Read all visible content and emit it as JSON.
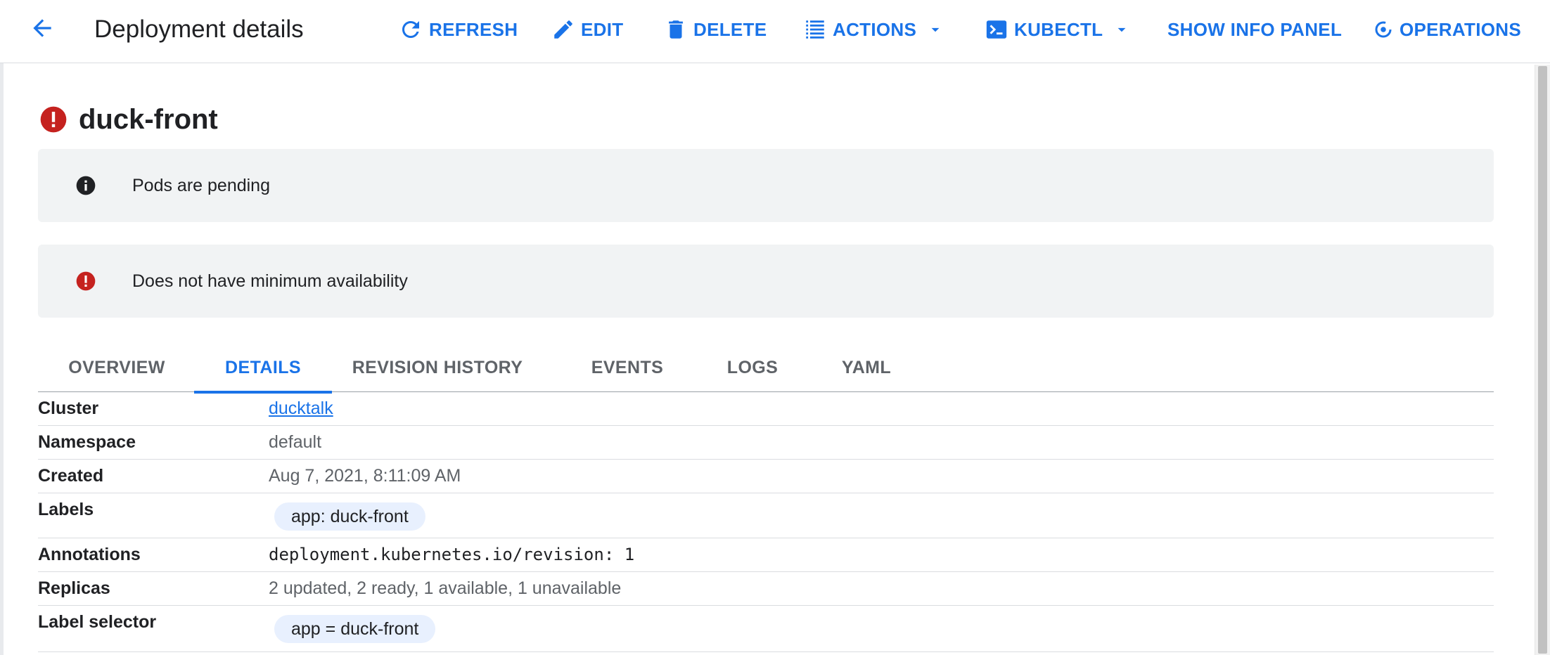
{
  "header": {
    "title": "Deployment details",
    "buttons": {
      "refresh": "REFRESH",
      "edit": "EDIT",
      "delete": "DELETE",
      "actions": "ACTIONS",
      "kubectl": "KUBECTL",
      "show_info_panel": "SHOW INFO PANEL",
      "operations": "OPERATIONS"
    }
  },
  "deployment": {
    "name": "duck-front",
    "status_icon": "error-icon"
  },
  "alerts": [
    {
      "icon": "info-icon",
      "text": "Pods are pending"
    },
    {
      "icon": "error-icon",
      "text": "Does not have minimum availability"
    }
  ],
  "tabs": [
    {
      "label": "OVERVIEW",
      "active": false
    },
    {
      "label": "DETAILS",
      "active": true
    },
    {
      "label": "REVISION HISTORY",
      "active": false
    },
    {
      "label": "EVENTS",
      "active": false
    },
    {
      "label": "LOGS",
      "active": false
    },
    {
      "label": "YAML",
      "active": false
    }
  ],
  "details": {
    "cluster": {
      "label": "Cluster",
      "value": "ducktalk"
    },
    "namespace": {
      "label": "Namespace",
      "value": "default"
    },
    "created": {
      "label": "Created",
      "value": "Aug 7, 2021, 8:11:09 AM"
    },
    "labels": {
      "label": "Labels",
      "chip": "app: duck-front"
    },
    "annotations": {
      "label": "Annotations",
      "value": "deployment.kubernetes.io/revision: 1"
    },
    "replicas": {
      "label": "Replicas",
      "value": "2 updated, 2 ready, 1 available, 1 unavailable"
    },
    "label_selector": {
      "label": "Label selector",
      "chip": "app = duck-front"
    }
  },
  "colors": {
    "accent": "#1a73e8",
    "error": "#c5221f",
    "alert_bg": "#f1f3f4",
    "chip_bg": "#e8f0fe"
  }
}
